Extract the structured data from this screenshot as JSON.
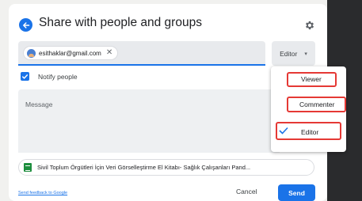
{
  "dialog": {
    "title": "Share with people and groups",
    "back_icon": "arrow-left-icon",
    "settings_icon": "gear-icon"
  },
  "recipients": {
    "chip_email": "esithaklar@gmail.com",
    "chip_close_glyph": "✕"
  },
  "role_dropdown": {
    "selected": "Editor",
    "caret_glyph": "▾"
  },
  "notify": {
    "label": "Notify people",
    "checked": true
  },
  "message": {
    "placeholder": "Message"
  },
  "document": {
    "title": "Sivil Toplum Örgütleri İçin Veri Görselleştirme El Kitabı- Sağlık Çalışanları Pand...",
    "icon": "google-sheets-icon"
  },
  "footer": {
    "feedback_link": "Send feedback to Google",
    "cancel_label": "Cancel",
    "send_label": "Send"
  },
  "role_menu": {
    "items": [
      {
        "label": "Viewer",
        "selected": false
      },
      {
        "label": "Commenter",
        "selected": false
      },
      {
        "label": "Editor",
        "selected": true
      }
    ],
    "highlight_color": "#e53935"
  },
  "colors": {
    "accent": "#1a73e8",
    "annotation_red": "#e53935"
  }
}
